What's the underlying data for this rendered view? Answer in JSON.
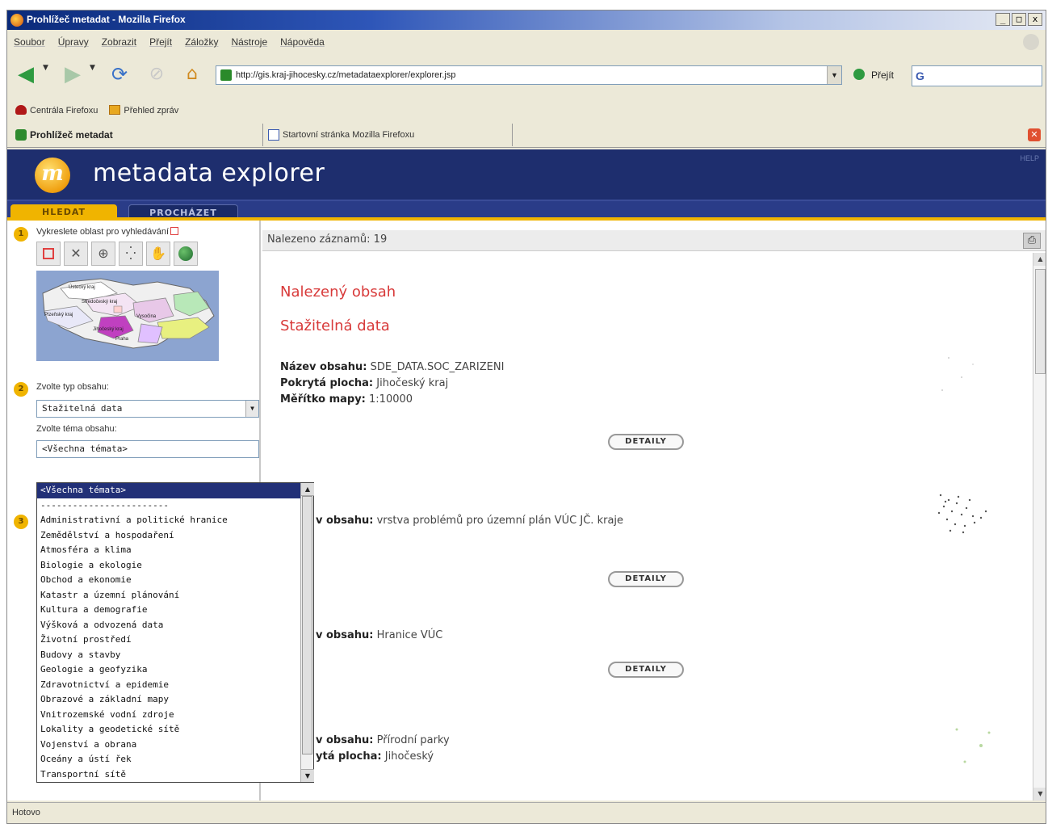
{
  "window": {
    "title": "Prohlížeč metadat - Mozilla Firefox",
    "controls": [
      "_",
      "□",
      "x"
    ]
  },
  "menu": [
    "Soubor",
    "Úpravy",
    "Zobrazit",
    "Přejít",
    "Záložky",
    "Nástroje",
    "Nápověda"
  ],
  "nav": {
    "url": "http://gis.kraj-jihocesky.cz/metadataexplorer/explorer.jsp",
    "go_label": "Přejít",
    "search_value": "G"
  },
  "bookmarks": [
    "Centrála Firefoxu",
    "Přehled zpráv"
  ],
  "tabs": [
    {
      "label": "Prohlížeč metadat"
    },
    {
      "label": "Startovní stránka Mozilla Firefoxu"
    }
  ],
  "app": {
    "logo_letter": "m",
    "title": "metadata explorer",
    "help": "HELP",
    "tabs": [
      "HLEDAT",
      "PROCHÁZET"
    ]
  },
  "left": {
    "step1": "1",
    "step1_label": "Vykreslete oblast pro vyhledávání",
    "map_tools": [
      "draw-rectangle",
      "clear",
      "zoom-in",
      "full-extent",
      "pan",
      "globe"
    ],
    "map_labels": [
      "Ústecký kraj",
      "Středočeský kraj",
      "Plzeňský kraj",
      "Vysočina",
      "Jihočeský kraj",
      "Praha"
    ],
    "step2": "2",
    "type_label": "Zvolte typ obsahu:",
    "type_value": "Stažitelná data",
    "theme_label": "Zvolte téma obsahu:",
    "theme_value": "<Všechna témata>",
    "step3": "3",
    "theme_options": [
      "<Všechna témata>",
      "------------------------",
      "Administrativní a politické hranice",
      "Zemědělství a hospodaření",
      "Atmosféra a klima",
      "Biologie a ekologie",
      "Obchod a ekonomie",
      "Katastr a územní plánování",
      "Kultura a demografie",
      "Výšková a odvozená data",
      "Životní prostředí",
      "Budovy a stavby",
      "Geologie a geofyzika",
      "Zdravotnictví a epidemie",
      "Obrazové a základní mapy",
      "Vnitrozemské vodní zdroje",
      "Lokality a geodetické sítě",
      "Vojenství a obrana",
      "Oceány a ústí řek",
      "Transportní sítě"
    ]
  },
  "right": {
    "found_count": "Nalezeno záznamů: 19",
    "heading1": "Nalezený obsah",
    "heading2": "Stažitelná data",
    "record1": {
      "name_label": "Název obsahu:",
      "name_value": "SDE_DATA.SOC_ZARIZENI",
      "area_label": "Pokrytá plocha:",
      "area_value": "Jihočeský kraj",
      "scale_label": "Měřítko mapy:",
      "scale_value": "1:10000"
    },
    "record2": {
      "name_label": "v obsahu:",
      "name_value": "vrstva problémů pro územní plán VÚC JČ. kraje"
    },
    "record3": {
      "name_label": "v obsahu:",
      "name_value": "Hranice VÚC"
    },
    "record4": {
      "name_label": "v obsahu:",
      "name_value": "Přírodní parky",
      "area_label": "ytá plocha:",
      "area_value": "Jihočeský"
    },
    "detail_label": "DETAILY"
  },
  "status": "Hotovo"
}
